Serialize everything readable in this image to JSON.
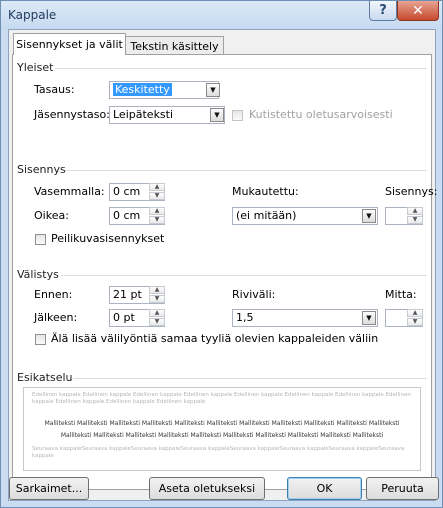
{
  "window": {
    "title": "Kappale",
    "help_glyph": "?",
    "close_glyph": "✕"
  },
  "tabs": [
    {
      "label": "Sisennykset ja välit"
    },
    {
      "label": "Tekstin käsittely"
    }
  ],
  "general": {
    "heading": "Yleiset",
    "alignment_label": "Tasaus:",
    "alignment_value": "Keskitetty",
    "outline_label": "Jäsennystaso:",
    "outline_value": "Leipäteksti",
    "collapsed_label": "Kutistettu oletusarvoisesti"
  },
  "indentation": {
    "heading": "Sisennys",
    "left_label": "Vasemmalla:",
    "left_value": "0 cm",
    "right_label": "Oikea:",
    "right_value": "0 cm",
    "special_label": "Mukautettu:",
    "special_value": "(ei mitään)",
    "by_label": "Sisennys:",
    "by_value": "",
    "mirror_label": "Peilikuvasisennykset"
  },
  "spacing": {
    "heading": "Välistys",
    "before_label": "Ennen:",
    "before_value": "21 pt",
    "after_label": "Jälkeen:",
    "after_value": "0 pt",
    "line_label": "Riviväli:",
    "line_value": "1,5",
    "at_label": "Mitta:",
    "at_value": "",
    "dont_add_label": "Älä lisää välilyöntiä samaa tyyliä olevien kappaleiden väliin"
  },
  "preview": {
    "heading": "Esikatselu",
    "previous_text": "Edellinen kappale Edellinen kappale Edellinen kappale Edellinen kappale Edellinen kappale Edellinen kappale Edellinen kappale Edellinen kappale Edellinen kappale Edellinen kappale Edellinen kappale",
    "sample_line1": "Malliteksti Malliteksti Malliteksti Malliteksti Malliteksti Malliteksti Malliteksti Malliteksti Malliteksti Malliteksti Malliteksti",
    "sample_line2": "Malliteksti Malliteksti Malliteksti Malliteksti Malliteksti Malliteksti Malliteksti Malliteksti Malliteksti Malliteksti",
    "next_text": "Seuraava kappaleSeuraava kappaleSeuraava kappaleSeuraava kappaleSeuraava kappaleSeuraava kappaleSeuraava kappaleSeuraava kappale"
  },
  "buttons": {
    "tabs": "Sarkaimet...",
    "set_default": "Aseta oletukseksi",
    "ok": "OK",
    "cancel": "Peruuta"
  }
}
